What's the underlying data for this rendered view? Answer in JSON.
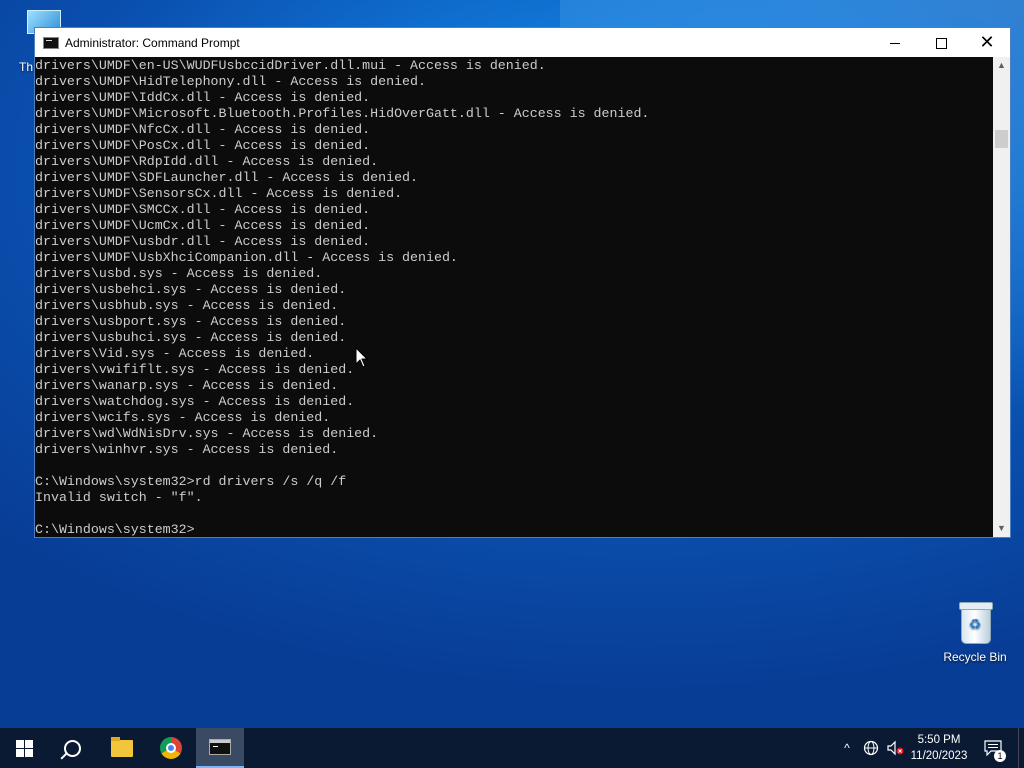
{
  "desktop": {
    "icons": [
      {
        "label": "Th"
      },
      {
        "label": "Recycle Bin"
      }
    ]
  },
  "window": {
    "title": "Administrator: Command Prompt",
    "controls": {
      "minimize": "minimize",
      "maximize": "maximize",
      "close": "close"
    }
  },
  "console": {
    "lines": [
      "drivers\\UMDF\\en-US\\WUDFUsbccidDriver.dll.mui - Access is denied.",
      "drivers\\UMDF\\HidTelephony.dll - Access is denied.",
      "drivers\\UMDF\\IddCx.dll - Access is denied.",
      "drivers\\UMDF\\Microsoft.Bluetooth.Profiles.HidOverGatt.dll - Access is denied.",
      "drivers\\UMDF\\NfcCx.dll - Access is denied.",
      "drivers\\UMDF\\PosCx.dll - Access is denied.",
      "drivers\\UMDF\\RdpIdd.dll - Access is denied.",
      "drivers\\UMDF\\SDFLauncher.dll - Access is denied.",
      "drivers\\UMDF\\SensorsCx.dll - Access is denied.",
      "drivers\\UMDF\\SMCCx.dll - Access is denied.",
      "drivers\\UMDF\\UcmCx.dll - Access is denied.",
      "drivers\\UMDF\\usbdr.dll - Access is denied.",
      "drivers\\UMDF\\UsbXhciCompanion.dll - Access is denied.",
      "drivers\\usbd.sys - Access is denied.",
      "drivers\\usbehci.sys - Access is denied.",
      "drivers\\usbhub.sys - Access is denied.",
      "drivers\\usbport.sys - Access is denied.",
      "drivers\\usbuhci.sys - Access is denied.",
      "drivers\\Vid.sys - Access is denied.",
      "drivers\\vwififlt.sys - Access is denied.",
      "drivers\\wanarp.sys - Access is denied.",
      "drivers\\watchdog.sys - Access is denied.",
      "drivers\\wcifs.sys - Access is denied.",
      "drivers\\wd\\WdNisDrv.sys - Access is denied.",
      "drivers\\winhvr.sys - Access is denied.",
      "",
      "C:\\Windows\\system32>rd drivers /s /q /f",
      "Invalid switch - \"f\".",
      "",
      "C:\\Windows\\system32>"
    ]
  },
  "taskbar": {
    "apps": [
      {
        "name": "start",
        "icon": "windows-logo-icon"
      },
      {
        "name": "search",
        "icon": "search-icon"
      },
      {
        "name": "file-explorer",
        "icon": "folder-icon"
      },
      {
        "name": "chrome",
        "icon": "chrome-icon"
      },
      {
        "name": "command-prompt",
        "icon": "cmd-icon",
        "active": true
      }
    ],
    "tray": {
      "chevron": "^",
      "time": "5:50 PM",
      "date": "11/20/2023",
      "notification_count": "1"
    }
  },
  "colors": {
    "console_bg": "#0c0c0c",
    "console_text": "#cccccc",
    "taskbar": "#0b1a33",
    "desktop": "#0a4fae"
  }
}
